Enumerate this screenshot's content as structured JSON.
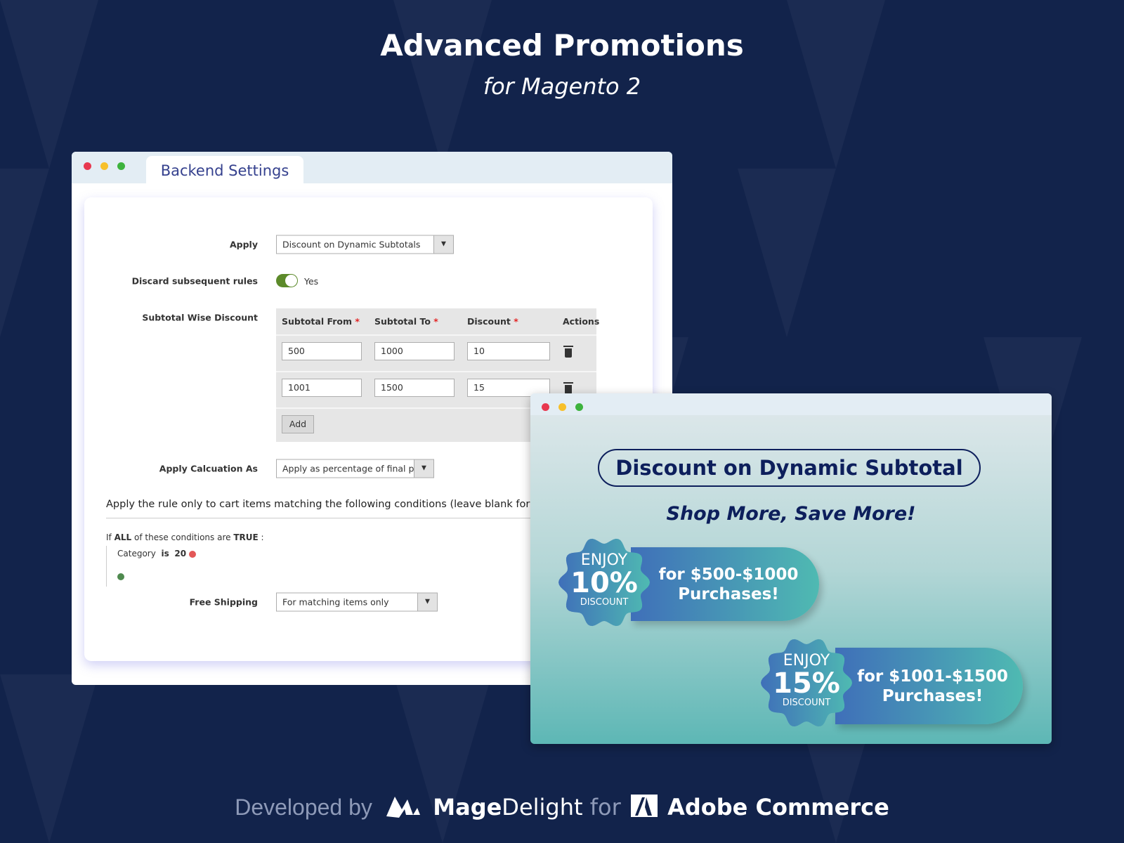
{
  "header": {
    "title": "Advanced Promotions",
    "subtitle": "for Magento 2"
  },
  "backend": {
    "tab": "Backend Settings",
    "apply_label": "Apply",
    "apply_value": "Discount on Dynamic Subtotals",
    "discard_label": "Discard subsequent rules",
    "discard_value": "Yes",
    "discard_on": true,
    "subtotal_label": "Subtotal Wise Discount",
    "columns": [
      "Subtotal From",
      "Subtotal To",
      "Discount",
      "Actions"
    ],
    "rows": [
      [
        "500",
        "1000",
        "10"
      ],
      [
        "1001",
        "1500",
        "15"
      ]
    ],
    "add_label": "Add",
    "calc_label": "Apply Calcuation As",
    "calc_value": "Apply as percentage of final price",
    "conditions_heading": "Apply the rule only to cart items matching the following conditions (leave blank for all items).",
    "cond_if": "If",
    "cond_all": "ALL",
    "cond_mid": "of these conditions are",
    "cond_true": "TRUE",
    "cond_colon": ":",
    "cond_attr": "Category",
    "cond_op": "is",
    "cond_val": "20",
    "ship_label": "Free Shipping",
    "ship_value": "For matching items only"
  },
  "promo": {
    "title": "Discount on Dynamic Subtotal",
    "tagline": "Shop More, Save More!",
    "offers": [
      {
        "enjoy": "ENJOY",
        "percent": "10%",
        "discount": "DISCOUNT",
        "line1": "for $500-$1000",
        "line2": "Purchases!"
      },
      {
        "enjoy": "ENJOY",
        "percent": "15%",
        "discount": "DISCOUNT",
        "line1": "for $1001-$1500",
        "line2": "Purchases!"
      }
    ]
  },
  "footer": {
    "developed": "Developed by",
    "brand_bold": "Mage",
    "brand_light": "Delight",
    "for": "for",
    "partner": "Adobe Commerce"
  },
  "colors": {
    "background": "#12234b",
    "accent": "#35418e",
    "toggle": "#5c8a2a",
    "promo_navy": "#0d1f5c"
  }
}
